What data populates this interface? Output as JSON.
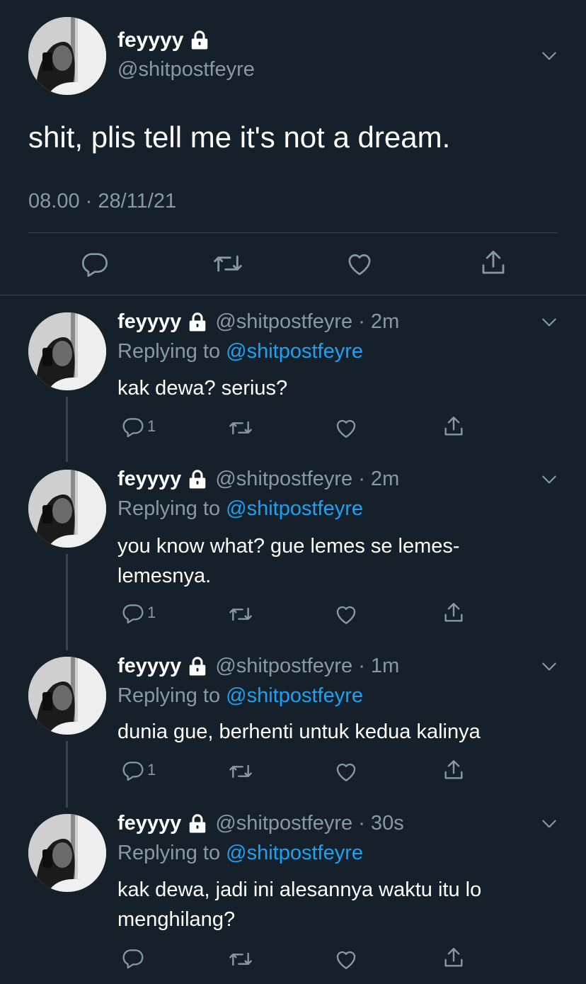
{
  "main_tweet": {
    "display_name": "feyyyy",
    "handle": "@shitpostfeyre",
    "text": "shit, plis tell me it's not a dream.",
    "timestamp": "08.00 · 28/11/21",
    "actions": [
      "reply-icon",
      "retweet-icon",
      "like-icon",
      "share-icon"
    ]
  },
  "replies": [
    {
      "display_name": "feyyyy",
      "handle_time": "@shitpostfeyre · 2m",
      "replying_prefix": "Replying to ",
      "replying_mention": "@shitpostfeyre",
      "text": "kak dewa? serius?",
      "reply_count": "1"
    },
    {
      "display_name": "feyyyy",
      "handle_time": "@shitpostfeyre · 2m",
      "replying_prefix": "Replying to ",
      "replying_mention": "@shitpostfeyre",
      "text": "you know what? gue lemes se lemes-lemesnya.",
      "reply_count": "1"
    },
    {
      "display_name": "feyyyy",
      "handle_time": "@shitpostfeyre · 1m",
      "replying_prefix": "Replying to ",
      "replying_mention": "@shitpostfeyre",
      "text": "dunia gue, berhenti untuk kedua kalinya",
      "reply_count": "1"
    },
    {
      "display_name": "feyyyy",
      "handle_time": "@shitpostfeyre · 30s",
      "replying_prefix": "Replying to ",
      "replying_mention": "@shitpostfeyre",
      "text": "kak dewa, jadi ini alesannya waktu itu lo menghilang?",
      "reply_count": ""
    }
  ],
  "colors": {
    "background": "#15202b",
    "text_primary": "#ffffff",
    "text_secondary": "#8899a6",
    "link": "#1da1f2",
    "divider": "#38444d"
  }
}
